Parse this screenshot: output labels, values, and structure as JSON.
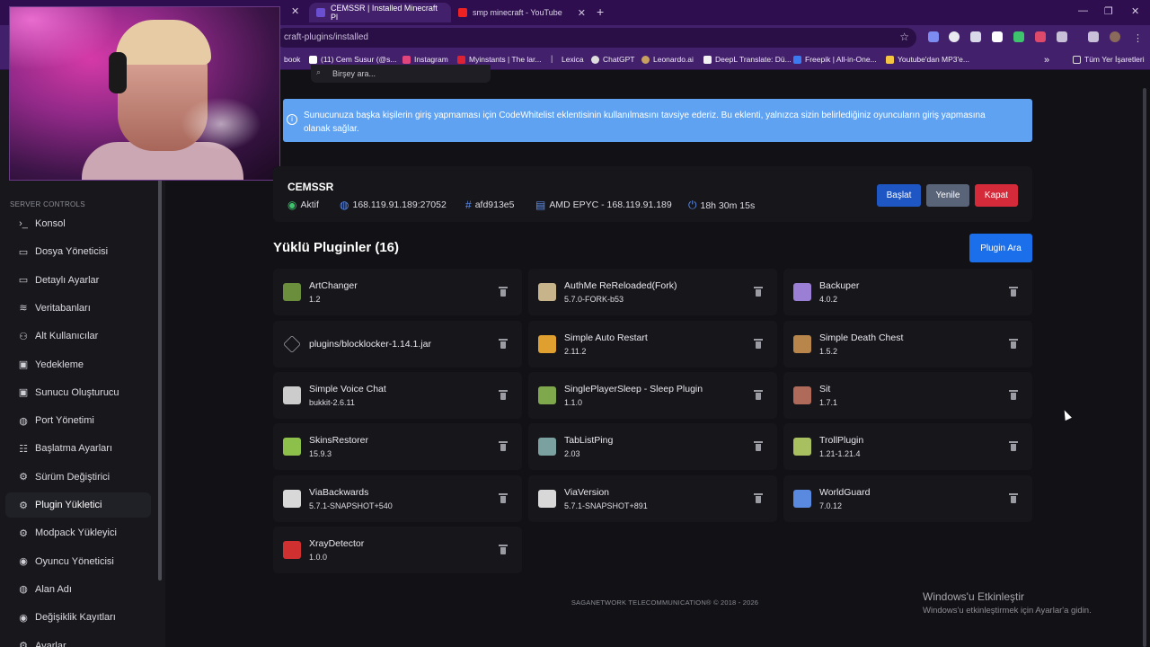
{
  "browser": {
    "tabs": [
      {
        "title": "CEMSSR | Installed Minecraft Pl",
        "active": true
      },
      {
        "title": "smp minecraft - YouTube",
        "active": false
      }
    ],
    "address": "craft-plugins/installed",
    "bookmarks": [
      "book",
      "(11) Cem Susur (@s...",
      "Instagram",
      "Myinstants | The lar...",
      "Lexica",
      "ChatGPT",
      "Leonardo.ai",
      "DeepL Translate: Dü...",
      "Freepik | All-in-One...",
      "Youtube'dan MP3'e...",
      "Tüm Yer İşaretleri"
    ],
    "bookmark_separator": "|",
    "more_bookmarks": "»"
  },
  "search": {
    "placeholder": "Birşey ara..."
  },
  "alert": {
    "text": "Sunucunuza başka kişilerin giriş yapmaması için CodeWhitelist eklentisinin kullanılmasını tavsiye ederiz. Bu eklenti, yalnızca sizin belirlediğiniz oyuncuların giriş yapmasına olanak sağlar."
  },
  "server": {
    "name": "CEMSSR",
    "status": "Aktif",
    "address": "168.119.91.189:27052",
    "id": "afd913e5",
    "node": "AMD EPYC - 168.119.91.189",
    "uptime": "18h 30m 15s",
    "buttons": {
      "start": "Başlat",
      "restart": "Yenile",
      "stop": "Kapat"
    }
  },
  "sidebar": {
    "section": "SERVER CONTROLS",
    "items": [
      {
        "label": "Konsol",
        "icon": ">_"
      },
      {
        "label": "Dosya Yöneticisi",
        "icon": "folder"
      },
      {
        "label": "Detaylı Ayarlar",
        "icon": "folder"
      },
      {
        "label": "Veritabanları",
        "icon": "database"
      },
      {
        "label": "Alt Kullanıcılar",
        "icon": "user"
      },
      {
        "label": "Yedekleme",
        "icon": "save"
      },
      {
        "label": "Sunucu Oluşturucu",
        "icon": "save"
      },
      {
        "label": "Port Yönetimi",
        "icon": "globe"
      },
      {
        "label": "Başlatma Ayarları",
        "icon": "sliders"
      },
      {
        "label": "Sürüm Değiştirici",
        "icon": "gear"
      },
      {
        "label": "Plugin Yükletici",
        "icon": "gear"
      },
      {
        "label": "Modpack Yükleyici",
        "icon": "gear"
      },
      {
        "label": "Oyuncu Yöneticisi",
        "icon": "eye"
      },
      {
        "label": "Alan Adı",
        "icon": "globe"
      },
      {
        "label": "Değişiklik Kayıtları",
        "icon": "eye"
      },
      {
        "label": "Ayarlar",
        "icon": "gear"
      }
    ],
    "active_index": 10
  },
  "plugins": {
    "heading": "Yüklü Pluginler (16)",
    "search_button": "Plugin Ara",
    "items": [
      {
        "name": "ArtChanger",
        "version": "1.2",
        "color": "#6b8e3c"
      },
      {
        "name": "AuthMe ReReloaded(Fork)",
        "version": "5.7.0-FORK-b53",
        "color": "#c8b48a"
      },
      {
        "name": "Backuper",
        "version": "4.0.2",
        "color": "#9a7fd4"
      },
      {
        "name": "plugins/blocklocker-1.14.1.jar",
        "version": "",
        "color": ""
      },
      {
        "name": "Simple Auto Restart",
        "version": "2.11.2",
        "color": "#e0a030"
      },
      {
        "name": "Simple Death Chest",
        "version": "1.5.2",
        "color": "#b8864b"
      },
      {
        "name": "Simple Voice Chat",
        "version": "bukkit-2.6.11",
        "color": "#cccccc"
      },
      {
        "name": "SinglePlayerSleep - Sleep Plugin",
        "version": "1.1.0",
        "color": "#7fa84c"
      },
      {
        "name": "Sit",
        "version": "1.7.1",
        "color": "#b06a5a"
      },
      {
        "name": "SkinsRestorer",
        "version": "15.9.3",
        "color": "#8cc04a"
      },
      {
        "name": "TabListPing",
        "version": "2.03",
        "color": "#7aa0a0"
      },
      {
        "name": "TrollPlugin",
        "version": "1.21-1.21.4",
        "color": "#a8c060"
      },
      {
        "name": "ViaBackwards",
        "version": "5.7.1-SNAPSHOT+540",
        "color": "#d8d8d8"
      },
      {
        "name": "ViaVersion",
        "version": "5.7.1-SNAPSHOT+891",
        "color": "#d8d8d8"
      },
      {
        "name": "WorldGuard",
        "version": "7.0.12",
        "color": "#5a8ae0"
      },
      {
        "name": "XrayDetector",
        "version": "1.0.0",
        "color": "#d03030"
      }
    ]
  },
  "footer": "SAGANETWORK TELECOMMUNICATION® © 2018 - 2026",
  "windows_activation": {
    "title": "Windows'u Etkinleştir",
    "subtitle": "Windows'u etkinleştirmek için Ayarlar'a gidin."
  }
}
